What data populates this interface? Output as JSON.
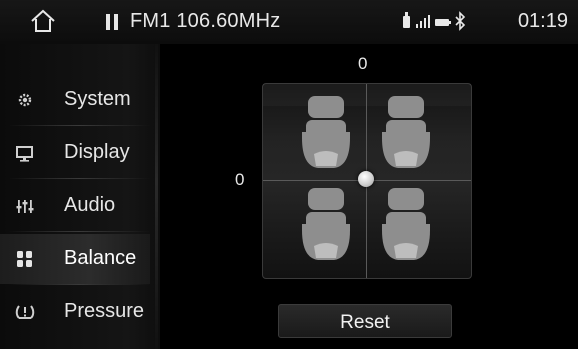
{
  "header": {
    "radio_label": "FM1 106.60MHz",
    "clock": "01:19",
    "status_icons": [
      "usb-icon",
      "signal-icon",
      "battery-icon",
      "bluetooth-icon"
    ]
  },
  "sidebar": {
    "items": [
      {
        "label": "System",
        "icon": "gear-icon",
        "active": false
      },
      {
        "label": "Display",
        "icon": "monitor-icon",
        "active": false
      },
      {
        "label": "Audio",
        "icon": "equalizer-icon",
        "active": false
      },
      {
        "label": "Balance",
        "icon": "balance-icon",
        "active": true
      },
      {
        "label": "Pressure",
        "icon": "tire-pressure-icon",
        "active": false
      }
    ]
  },
  "balance": {
    "front_rear_value": "0",
    "left_right_value": "0",
    "reset_label": "Reset"
  }
}
